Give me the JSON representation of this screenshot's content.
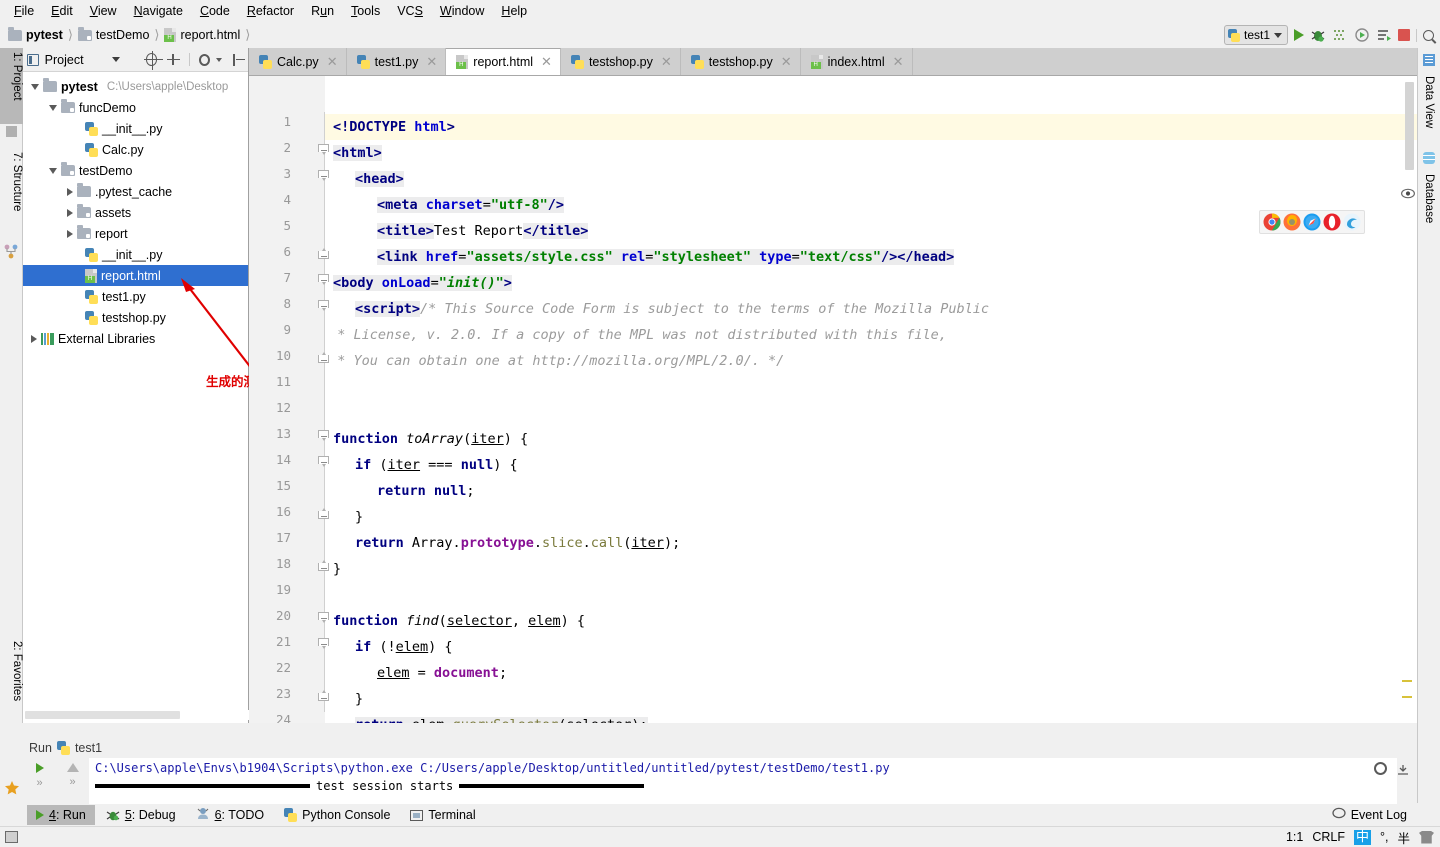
{
  "menu": {
    "items": [
      "File",
      "Edit",
      "View",
      "Navigate",
      "Code",
      "Refactor",
      "Run",
      "Tools",
      "VCS",
      "Window",
      "Help"
    ]
  },
  "breadcrumb": {
    "items": [
      {
        "label": "pytest",
        "icon": "folder-icon",
        "bold": true
      },
      {
        "label": "testDemo",
        "icon": "folder-source-icon",
        "bold": false
      },
      {
        "label": "report.html",
        "icon": "html-file-icon",
        "bold": false
      }
    ]
  },
  "toolbar": {
    "run_config": "test1",
    "buttons": [
      "run-button",
      "debug-button",
      "coverage-button",
      "profile-button",
      "rerun-button",
      "stop-button",
      "search-everywhere-button"
    ]
  },
  "left_tool_tabs": [
    {
      "label": "1: Project",
      "selected": true
    },
    {
      "label": "7: Structure",
      "selected": false
    },
    {
      "label": "2: Favorites",
      "selected": false
    }
  ],
  "right_tool_tabs": [
    {
      "label": "Data View",
      "icon": "grid-icon"
    },
    {
      "label": "Database",
      "icon": "database-icon"
    }
  ],
  "project_panel": {
    "title": "Project",
    "toolbar_icons": [
      "chevron-down-icon",
      "locate-icon",
      "expand-collapse-icon",
      "gear-icon",
      "hide-icon"
    ],
    "tree": [
      {
        "label": "pytest",
        "path": "C:\\Users\\apple\\Desktop",
        "indent": 0,
        "twisty": "down",
        "icon": "folder-icon",
        "bold": true,
        "selected": false
      },
      {
        "label": "funcDemo",
        "path": "",
        "indent": 1,
        "twisty": "down",
        "icon": "folder-source-icon",
        "bold": false,
        "selected": false
      },
      {
        "label": "__init__.py",
        "path": "",
        "indent": 2,
        "twisty": "none",
        "icon": "python-file-icon",
        "bold": false,
        "selected": false
      },
      {
        "label": "Calc.py",
        "path": "",
        "indent": 2,
        "twisty": "none",
        "icon": "python-file-icon",
        "bold": false,
        "selected": false
      },
      {
        "label": "testDemo",
        "path": "",
        "indent": 1,
        "twisty": "down",
        "icon": "folder-source-icon",
        "bold": false,
        "selected": false
      },
      {
        "label": ".pytest_cache",
        "path": "",
        "indent": 2,
        "twisty": "right",
        "icon": "folder-icon",
        "bold": false,
        "selected": false
      },
      {
        "label": "assets",
        "path": "",
        "indent": 2,
        "twisty": "right",
        "icon": "folder-source-icon",
        "bold": false,
        "selected": false
      },
      {
        "label": "report",
        "path": "",
        "indent": 2,
        "twisty": "right",
        "icon": "folder-source-icon",
        "bold": false,
        "selected": false
      },
      {
        "label": "__init__.py",
        "path": "",
        "indent": 2,
        "twisty": "none",
        "icon": "python-file-icon",
        "bold": false,
        "selected": false
      },
      {
        "label": "report.html",
        "path": "",
        "indent": 2,
        "twisty": "none",
        "icon": "html-file-icon",
        "bold": false,
        "selected": true
      },
      {
        "label": "test1.py",
        "path": "",
        "indent": 2,
        "twisty": "none",
        "icon": "python-file-icon",
        "bold": false,
        "selected": false
      },
      {
        "label": "testshop.py",
        "path": "",
        "indent": 2,
        "twisty": "none",
        "icon": "python-file-icon",
        "bold": false,
        "selected": false
      },
      {
        "label": "External Libraries",
        "path": "",
        "indent": 0,
        "twisty": "right",
        "icon": "library-icon",
        "bold": false,
        "selected": false
      }
    ]
  },
  "annotation": {
    "text": "生成的测试报告",
    "color": "#e00000"
  },
  "editor_tabs": [
    {
      "label": "Calc.py",
      "icon": "python-file-icon",
      "active": false
    },
    {
      "label": "test1.py",
      "icon": "python-file-icon",
      "active": false
    },
    {
      "label": "report.html",
      "icon": "html-file-icon",
      "active": true
    },
    {
      "label": "testshop.py",
      "icon": "python-file-icon",
      "active": false
    },
    {
      "label": "testshop.py",
      "icon": "python-file-icon",
      "active": false
    },
    {
      "label": "index.html",
      "icon": "html-file-icon",
      "active": false
    }
  ],
  "editor": {
    "browser_icons": [
      "chrome-icon",
      "firefox-icon",
      "safari-icon",
      "opera-icon",
      "edge-icon"
    ],
    "line_numbers": [
      1,
      2,
      3,
      4,
      5,
      6,
      7,
      8,
      9,
      10,
      11,
      12,
      13,
      14,
      15,
      16,
      17,
      18,
      19,
      20,
      21,
      22,
      23,
      24
    ],
    "lines": [
      {
        "n": 1,
        "indent": 0,
        "current": true
      },
      {
        "n": 2,
        "indent": 0
      },
      {
        "n": 3,
        "indent": 1
      },
      {
        "n": 4,
        "indent": 2
      },
      {
        "n": 5,
        "indent": 2
      },
      {
        "n": 6,
        "indent": 2
      },
      {
        "n": 7,
        "indent": 0
      },
      {
        "n": 8,
        "indent": 1
      },
      {
        "n": 9,
        "indent": 0
      },
      {
        "n": 10,
        "indent": 0
      },
      {
        "n": 11,
        "indent": 0
      },
      {
        "n": 12,
        "indent": 0
      },
      {
        "n": 13,
        "indent": 0
      },
      {
        "n": 14,
        "indent": 1
      },
      {
        "n": 15,
        "indent": 2
      },
      {
        "n": 16,
        "indent": 1
      },
      {
        "n": 17,
        "indent": 1
      },
      {
        "n": 18,
        "indent": 0
      },
      {
        "n": 19,
        "indent": 0
      },
      {
        "n": 20,
        "indent": 0
      },
      {
        "n": 21,
        "indent": 1
      },
      {
        "n": 22,
        "indent": 2
      },
      {
        "n": 23,
        "indent": 1
      },
      {
        "n": 24,
        "indent": 1
      }
    ],
    "code_text": {
      "l1": "<!DOCTYPE html>",
      "l2": "<html>",
      "l3": "<head>",
      "l4": "<meta charset=\"utf-8\"/>",
      "l5": "<title>Test Report</title>",
      "l6": "<link href=\"assets/style.css\" rel=\"stylesheet\" type=\"text/css\"/></head>",
      "l7": "<body onLoad=\"init()\">",
      "l8": "<script>/* This Source Code Form is subject to the terms of the Mozilla Public",
      "l9": "* License, v. 2.0. If a copy of the MPL was not distributed with this file,",
      "l10": "* You can obtain one at http://mozilla.org/MPL/2.0/. */",
      "l13": "function toArray(iter) {",
      "l14": "if (iter === null) {",
      "l15": "return null;",
      "l16": "}",
      "l17": "return Array.prototype.slice.call(iter);",
      "l18": "}",
      "l20": "function find(selector, elem) {",
      "l21": "if (!elem) {",
      "l22": "elem = document;",
      "l23": "}",
      "l24": "return elem.querySelector(selector);"
    }
  },
  "run_panel": {
    "header_label": "Run",
    "header_config": "test1",
    "console_command": "C:\\Users\\apple\\Envs\\b1904\\Scripts\\python.exe C:/Users/apple/Desktop/untitled/untitled/pytest/testDemo/test1.py",
    "console_separator": "test session starts"
  },
  "bottom_tabs": [
    {
      "label": "4: Run",
      "icon": "run-icon",
      "selected": true
    },
    {
      "label": "5: Debug",
      "icon": "debug-icon",
      "selected": false
    },
    {
      "label": "6: TODO",
      "icon": "todo-icon",
      "selected": false
    },
    {
      "label": "Python Console",
      "icon": "python-icon",
      "selected": false
    },
    {
      "label": "Terminal",
      "icon": "terminal-icon",
      "selected": false
    }
  ],
  "event_log": {
    "label": "Event Log",
    "icon": "balloon-icon"
  },
  "status_bar": {
    "caret_position": "1:1",
    "line_separator": "CRLF",
    "ime_indicators": [
      "中",
      "°,",
      "半"
    ]
  },
  "colors": {
    "selection_blue": "#2f6fd0",
    "tag_navy": "#000080",
    "attr_blue": "#0000d0",
    "string_green": "#008000",
    "comment_gray": "#9b9b9b",
    "property_purple": "#871094",
    "method_olive": "#7a7a3c",
    "current_line": "#fffae3",
    "annotation_red": "#e00000"
  }
}
